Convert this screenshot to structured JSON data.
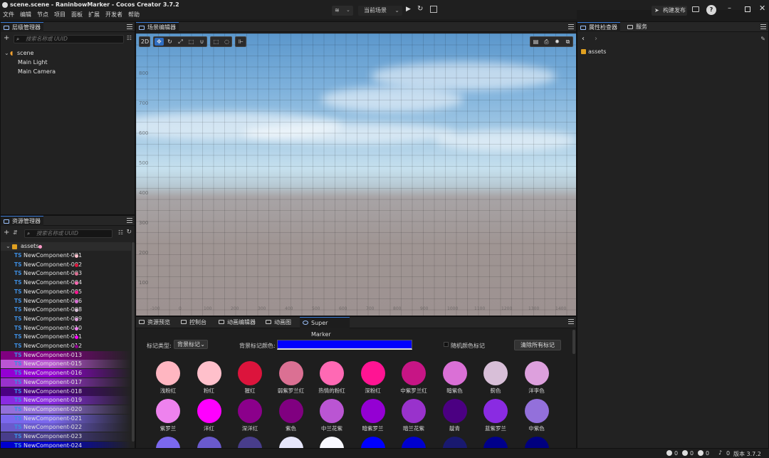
{
  "window": {
    "title": "scene.scene - RaninbowMarker - Cocos Creator 3.7.2"
  },
  "menu": [
    "文件",
    "编辑",
    "节点",
    "项目",
    "面板",
    "扩展",
    "开发者",
    "帮助"
  ],
  "toolbar": {
    "scene_select": "当前场景",
    "build_label": "构建发布"
  },
  "hierarchy": {
    "tab": "层级管理器",
    "search_placeholder": "搜索名称或 UUID",
    "root": "scene",
    "children": [
      "Main Light",
      "Main Camera"
    ]
  },
  "scene_editor": {
    "tab": "场景编辑器",
    "mode_2d": "2D",
    "y_labels": [
      "800",
      "700",
      "600",
      "500",
      "400",
      "300",
      "200",
      "100"
    ],
    "x_labels": [
      "-100",
      "0",
      "100",
      "200",
      "300",
      "400",
      "500",
      "600",
      "700",
      "800",
      "900",
      "1000",
      "1100",
      "1200",
      "1300",
      "1400"
    ]
  },
  "inspector": {
    "tabs": [
      "属性检查器",
      "服务"
    ],
    "asset": "assets"
  },
  "assets_panel": {
    "tab": "资源管理器",
    "search_placeholder": "搜索名称或 UUID",
    "root": "assets",
    "root_dot": "#ff9ac8",
    "items": [
      {
        "name": "NewComponent-001",
        "dot": "#ffc0cb",
        "bg": ""
      },
      {
        "name": "NewComponent-002",
        "dot": "#dc143c",
        "bg": ""
      },
      {
        "name": "NewComponent-003",
        "dot": "#db7093",
        "bg": ""
      },
      {
        "name": "NewComponent-004",
        "dot": "#ff69b4",
        "bg": ""
      },
      {
        "name": "NewComponent-005",
        "dot": "#ff1493",
        "bg": ""
      },
      {
        "name": "NewComponent-006",
        "dot": "#da70d6",
        "bg": ""
      },
      {
        "name": "NewComponent-008",
        "dot": "#d8bfd8",
        "bg": ""
      },
      {
        "name": "NewComponent-009",
        "dot": "#dda0dd",
        "bg": ""
      },
      {
        "name": "NewComponent-010",
        "dot": "#ee82ee",
        "bg": ""
      },
      {
        "name": "NewComponent-011",
        "dot": "#ff00ff",
        "bg": ""
      },
      {
        "name": "NewComponent-012",
        "dot": "#8b008b",
        "bg": ""
      },
      {
        "name": "NewComponent-013",
        "dot": "",
        "bg": "#800080"
      },
      {
        "name": "NewComponent-015",
        "dot": "",
        "bg": "#ba55d3"
      },
      {
        "name": "NewComponent-016",
        "dot": "",
        "bg": "#9400d3"
      },
      {
        "name": "NewComponent-017",
        "dot": "",
        "bg": "#9932cc"
      },
      {
        "name": "NewComponent-018",
        "dot": "",
        "bg": "#4b0082"
      },
      {
        "name": "NewComponent-019",
        "dot": "",
        "bg": "#8a2be2"
      },
      {
        "name": "NewComponent-020",
        "dot": "",
        "bg": "#9370db"
      },
      {
        "name": "NewComponent-021",
        "dot": "",
        "bg": "#7b68ee"
      },
      {
        "name": "NewComponent-022",
        "dot": "",
        "bg": "#6a5acd"
      },
      {
        "name": "NewComponent-023",
        "dot": "",
        "bg": "#483d8b"
      },
      {
        "name": "NewComponent-024",
        "dot": "",
        "bg": "#0000cd"
      }
    ]
  },
  "bottom_tabs": [
    "资源预览",
    "控制台",
    "动画编辑器",
    "动画图",
    "Super Marker"
  ],
  "marker": {
    "type_label": "标记类型:",
    "type_value": "背景标记",
    "color_label": "背景标记颜色:",
    "color_value": "#0000ff",
    "random_label": "随机颜色标记",
    "clear_button": "清除所有标记",
    "swatches_row1": [
      {
        "name": "浅粉红",
        "color": "#ffb6c1"
      },
      {
        "name": "粉红",
        "color": "#ffc0cb"
      },
      {
        "name": "猩红",
        "color": "#dc143c"
      },
      {
        "name": "弱紫罗兰红",
        "color": "#db7093"
      },
      {
        "name": "热情的粉红",
        "color": "#ff69b4"
      },
      {
        "name": "深粉红",
        "color": "#ff1493"
      },
      {
        "name": "中紫罗兰红",
        "color": "#c71585"
      },
      {
        "name": "暗紫色",
        "color": "#da70d6"
      },
      {
        "name": "蓟色",
        "color": "#d8bfd8"
      },
      {
        "name": "洋李色",
        "color": "#dda0dd"
      }
    ],
    "swatches_row2": [
      {
        "name": "紫罗兰",
        "color": "#ee82ee"
      },
      {
        "name": "洋红",
        "color": "#ff00ff"
      },
      {
        "name": "深洋红",
        "color": "#8b008b"
      },
      {
        "name": "紫色",
        "color": "#800080"
      },
      {
        "name": "中兰花紫",
        "color": "#ba55d3"
      },
      {
        "name": "暗紫罗兰",
        "color": "#9400d3"
      },
      {
        "name": "暗兰花紫",
        "color": "#9932cc"
      },
      {
        "name": "靛青",
        "color": "#4b0082"
      },
      {
        "name": "蓝紫罗兰",
        "color": "#8a2be2"
      },
      {
        "name": "中紫色",
        "color": "#9370db"
      }
    ],
    "swatches_row3": [
      "#7b68ee",
      "#6a5acd",
      "#483d8b",
      "#e6e6fa",
      "#f8f8ff",
      "#0000ff",
      "#0000cd",
      "#191970",
      "#00008b",
      "#000080"
    ]
  },
  "status": {
    "info": "0",
    "warn": "0",
    "err": "0",
    "notify": "0",
    "version": "版本 3.7.2"
  }
}
